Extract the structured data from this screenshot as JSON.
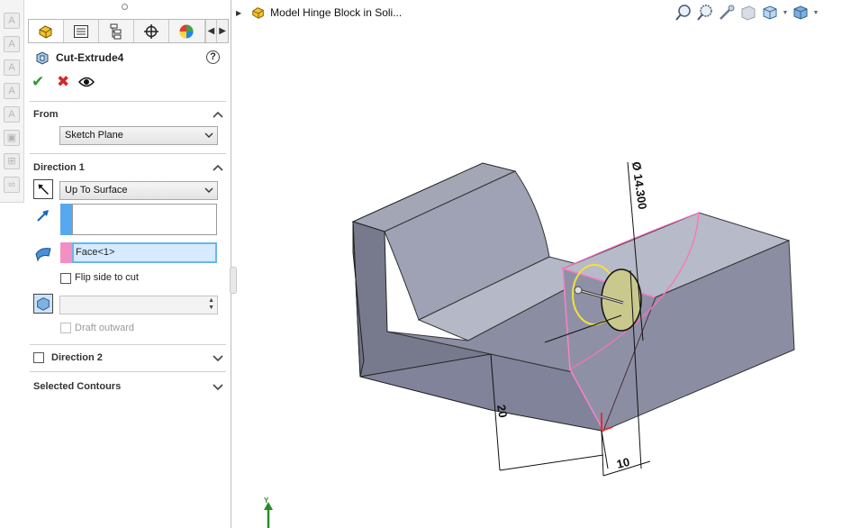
{
  "pm": {
    "title": "Cut-Extrude4",
    "help": "?",
    "from": {
      "label": "From",
      "value": "Sketch Plane"
    },
    "direction1": {
      "label": "Direction 1",
      "end_condition": "Up To Surface",
      "face_selection": "Face<1>",
      "flip_label": "Flip side to cut",
      "draft_label": "Draft outward"
    },
    "direction2": {
      "label": "Direction 2"
    },
    "contours": {
      "label": "Selected Contours"
    }
  },
  "tree": {
    "title": "Model Hinge Block in Soli..."
  },
  "dimensions": {
    "diameter": "Ø 14.300",
    "height": "20",
    "width": "10"
  },
  "triad": {
    "axis": "Y"
  },
  "colors": {
    "face_swatch": "#f48fc2",
    "dir_swatch": "#56a8ef",
    "accept": "#2e9a2e",
    "cancel": "#d62828",
    "model": "#8f93a6"
  }
}
